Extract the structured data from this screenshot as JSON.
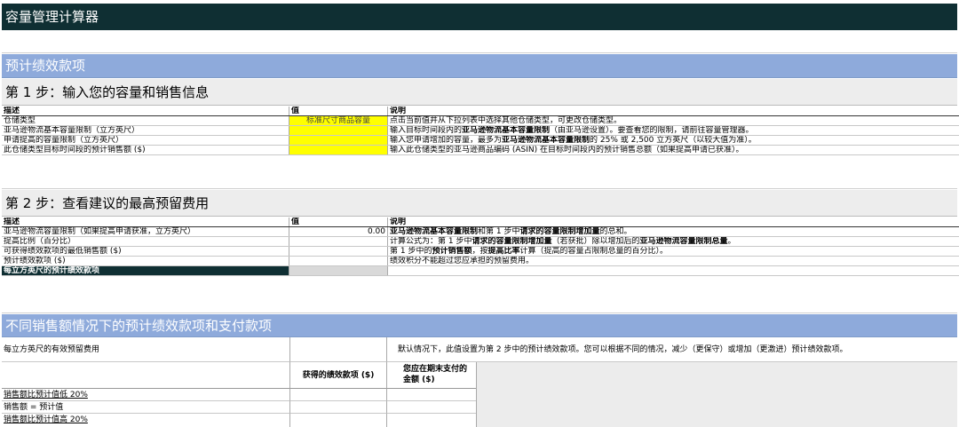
{
  "title": "容量管理计算器",
  "section1": {
    "title": "预计绩效款项"
  },
  "step1": {
    "title": "第 1 步：输入您的容量和销售信息",
    "headers": {
      "desc": "描述",
      "value": "值",
      "note": "说明"
    },
    "rows": [
      {
        "desc": "仓储类型",
        "value": "标准尺寸商品容量",
        "note": [
          {
            "t": "点击当前值并从下拉列表中选择其他仓储类型，可更改仓储类型。",
            "b": false
          }
        ]
      },
      {
        "desc": "亚马逊物流基本容量限制（立方英尺）",
        "value": "",
        "note": [
          {
            "t": "输入目标时间段内的",
            "b": false
          },
          {
            "t": "亚马逊物流基本容量限制",
            "b": true
          },
          {
            "t": "（由亚马逊设置）。要查看您的限制，请前往容量管理器。",
            "b": false
          }
        ]
      },
      {
        "desc": "申请提高的容量限制（立方英尺）",
        "value": "",
        "note": [
          {
            "t": "输入您申请增加的容量，最多为",
            "b": false
          },
          {
            "t": "亚马逊物流基本容量限制",
            "b": true
          },
          {
            "t": "的 25% 或 2,500 立方英尺（以较大值为准）。",
            "b": false
          }
        ]
      },
      {
        "desc": "此仓储类型目标时间段的预计销售额 ($)",
        "value": "",
        "note": [
          {
            "t": "输入此仓储类型的亚马逊商品编码 (ASIN) 在目标时间段内的预计销售总额（如果提高申请已获准）。",
            "b": false
          }
        ]
      }
    ]
  },
  "step2": {
    "title": "第 2 步：查看建议的最高预留费用",
    "headers": {
      "desc": "描述",
      "value": "值",
      "note": "说明"
    },
    "rows": [
      {
        "desc": "亚马逊物流容量限制（如果提高申请获准，立方英尺）",
        "value": "0.00",
        "note": [
          {
            "t": "亚马逊物流基本容量限制",
            "b": true
          },
          {
            "t": "和第 1 步中",
            "b": false
          },
          {
            "t": "请求的容量限制增加量",
            "b": true
          },
          {
            "t": "的总和。",
            "b": false
          }
        ]
      },
      {
        "desc": "提高比例（百分比）",
        "value": "",
        "note": [
          {
            "t": "计算公式为：第 1 步中",
            "b": false
          },
          {
            "t": "请求的容量限制增加量",
            "b": true
          },
          {
            "t": "（若获批）除以增加后的",
            "b": false
          },
          {
            "t": "亚马逊物流容量限制总量",
            "b": true
          },
          {
            "t": "。",
            "b": false
          }
        ]
      },
      {
        "desc": "可获得绩效款项的最低销售额 ($)",
        "value": "",
        "note": [
          {
            "t": "第 1 步中的",
            "b": false
          },
          {
            "t": "预计销售额",
            "b": true
          },
          {
            "t": "，按",
            "b": false
          },
          {
            "t": "提高比率",
            "b": true
          },
          {
            "t": "计算（提高的容量占限制总量的百分比）。",
            "b": false
          }
        ]
      },
      {
        "desc": "预计绩效款项 ($)",
        "value": "",
        "note": [
          {
            "t": "绩效积分不能超过您应承担的预留费用。",
            "b": false
          }
        ]
      },
      {
        "desc": "每立方英尺的预计绩效款项",
        "value": "",
        "note": []
      }
    ]
  },
  "section2": {
    "title": "不同销售额情况下的预计绩效款项和支付款项"
  },
  "bottom": {
    "fee_label": "每立方英尺的有效预留费用",
    "fee_note": "默认情况下，此值设置为第 2 步中的预计绩效款项。您可以根据不同的情况，减少（更保守）或增加（更激进）预计绩效款项。",
    "col_earned": "获得的绩效款项 ($)",
    "col_paid_1": "您应在期末支付的",
    "col_paid_2": "金额 ($)",
    "scenarios": [
      "销售额比预计值低 20%",
      "销售额 = 预计值",
      "销售额比预计值高 20%"
    ]
  }
}
